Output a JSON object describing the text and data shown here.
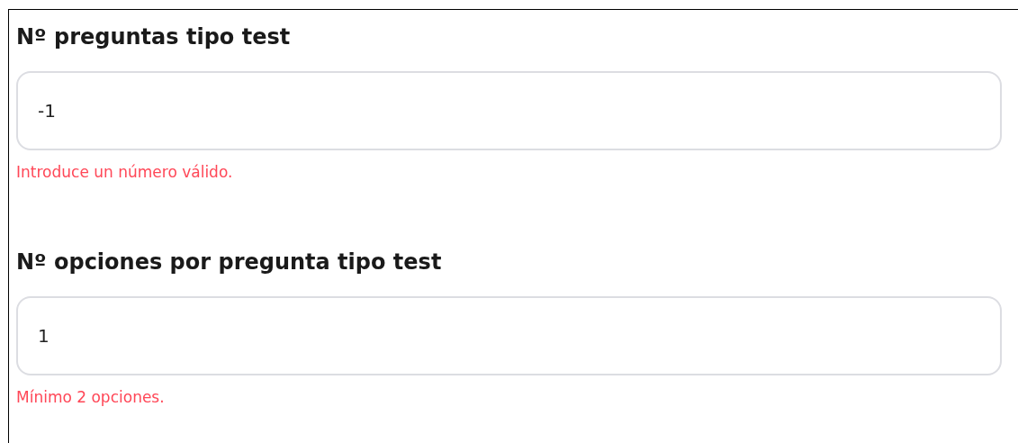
{
  "fields": [
    {
      "label": "Nº preguntas tipo test",
      "value": "-1",
      "error": "Introduce un número válido."
    },
    {
      "label": "Nº opciones por pregunta tipo test",
      "value": "1",
      "error": "Mínimo 2 opciones."
    }
  ]
}
